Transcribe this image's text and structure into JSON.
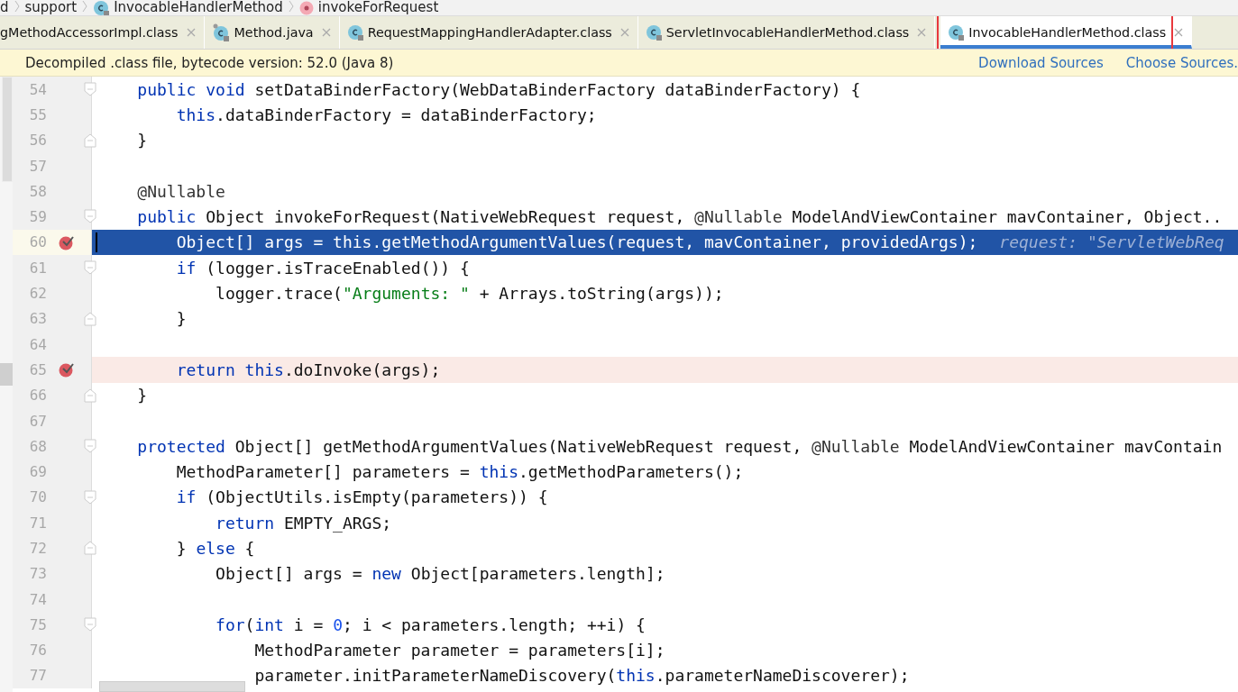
{
  "breadcrumbs": [
    {
      "label": "d",
      "kind": "plain"
    },
    {
      "label": "support",
      "kind": "plain"
    },
    {
      "label": "InvocableHandlerMethod",
      "kind": "class"
    },
    {
      "label": "invokeForRequest",
      "kind": "method"
    }
  ],
  "tabs": [
    {
      "label": "gMethodAccessorImpl.class",
      "kind": "plain",
      "selected": false
    },
    {
      "label": "Method.java",
      "kind": "pinned",
      "selected": false
    },
    {
      "label": "RequestMappingHandlerAdapter.class",
      "kind": "class",
      "selected": false
    },
    {
      "label": "ServletInvocableHandlerMethod.class",
      "kind": "class",
      "selected": false
    },
    {
      "label": "InvocableHandlerMethod.class",
      "kind": "class",
      "selected": true
    }
  ],
  "banner": {
    "message": "Decompiled .class file, bytecode version: 52.0 (Java 8)",
    "links": [
      "Download Sources",
      "Choose Sources."
    ]
  },
  "lines": [
    {
      "number": "54",
      "fold_start": true,
      "fold_end": false,
      "breakpoint": false,
      "execution_point": false,
      "tokens": [
        {
          "kind": "kw",
          "text": "    public void "
        },
        {
          "kind": "plain",
          "text": "setDataBinderFactory(WebDataBinderFactory dataBinderFactory) {"
        }
      ]
    },
    {
      "number": "55",
      "fold_start": false,
      "fold_end": false,
      "breakpoint": false,
      "execution_point": false,
      "tokens": [
        {
          "kind": "kw",
          "text": "        this"
        },
        {
          "kind": "plain",
          "text": ".dataBinderFactory = dataBinderFactory;"
        }
      ]
    },
    {
      "number": "56",
      "fold_start": false,
      "fold_end": true,
      "breakpoint": false,
      "execution_point": false,
      "tokens": [
        {
          "kind": "plain",
          "text": "    }"
        }
      ]
    },
    {
      "number": "57",
      "fold_start": false,
      "fold_end": false,
      "breakpoint": false,
      "execution_point": false
    },
    {
      "number": "58",
      "fold_start": false,
      "fold_end": false,
      "breakpoint": false,
      "execution_point": false,
      "tokens": [
        {
          "kind": "ann",
          "text": "    @Nullable"
        }
      ]
    },
    {
      "number": "59",
      "fold_start": true,
      "fold_end": false,
      "breakpoint": false,
      "execution_point": false,
      "tokens": [
        {
          "kind": "kw",
          "text": "    public "
        },
        {
          "kind": "plain",
          "text": "Object invokeForRequest(NativeWebRequest request, "
        },
        {
          "kind": "ann",
          "text": "@Nullable "
        },
        {
          "kind": "plain",
          "text": "ModelAndViewContainer mavContainer, Object.."
        }
      ]
    },
    {
      "number": "60",
      "fold_start": false,
      "fold_end": false,
      "breakpoint": true,
      "execution_point": true,
      "tokens": [
        {
          "kind": "plain",
          "text": "        Object[] args = "
        },
        {
          "kind": "kw",
          "text": "this"
        },
        {
          "kind": "plain",
          "text": ".getMethodArgumentValues(request, mavContainer, providedArgs);"
        }
      ],
      "hint": "request: \"ServletWebReq"
    },
    {
      "number": "61",
      "fold_start": true,
      "fold_end": false,
      "breakpoint": false,
      "execution_point": false,
      "tokens": [
        {
          "kind": "kw",
          "text": "        if "
        },
        {
          "kind": "plain",
          "text": "(logger.isTraceEnabled()) {"
        }
      ]
    },
    {
      "number": "62",
      "fold_start": false,
      "fold_end": false,
      "breakpoint": false,
      "execution_point": false,
      "tokens": [
        {
          "kind": "plain",
          "text": "            logger.trace("
        },
        {
          "kind": "str",
          "text": "\"Arguments: \""
        },
        {
          "kind": "plain",
          "text": " + Arrays.toString(args));"
        }
      ]
    },
    {
      "number": "63",
      "fold_start": false,
      "fold_end": true,
      "breakpoint": false,
      "execution_point": false,
      "tokens": [
        {
          "kind": "plain",
          "text": "        }"
        }
      ]
    },
    {
      "number": "64",
      "fold_start": false,
      "fold_end": false,
      "breakpoint": false,
      "execution_point": false
    },
    {
      "number": "65",
      "fold_start": false,
      "fold_end": false,
      "breakpoint": true,
      "execution_point": false,
      "tokens": [
        {
          "kind": "kw",
          "text": "        return this"
        },
        {
          "kind": "plain",
          "text": ".doInvoke(args);"
        }
      ]
    },
    {
      "number": "66",
      "fold_start": false,
      "fold_end": true,
      "breakpoint": false,
      "execution_point": false,
      "tokens": [
        {
          "kind": "plain",
          "text": "    }"
        }
      ]
    },
    {
      "number": "67",
      "fold_start": false,
      "fold_end": false,
      "breakpoint": false,
      "execution_point": false
    },
    {
      "number": "68",
      "fold_start": true,
      "fold_end": false,
      "breakpoint": false,
      "execution_point": false,
      "tokens": [
        {
          "kind": "kw",
          "text": "    protected "
        },
        {
          "kind": "plain",
          "text": "Object[] getMethodArgumentValues(NativeWebRequest request, "
        },
        {
          "kind": "ann",
          "text": "@Nullable "
        },
        {
          "kind": "plain",
          "text": "ModelAndViewContainer mavContain"
        }
      ]
    },
    {
      "number": "69",
      "fold_start": false,
      "fold_end": false,
      "breakpoint": false,
      "execution_point": false,
      "tokens": [
        {
          "kind": "plain",
          "text": "        MethodParameter[] parameters = "
        },
        {
          "kind": "kw",
          "text": "this"
        },
        {
          "kind": "plain",
          "text": ".getMethodParameters();"
        }
      ]
    },
    {
      "number": "70",
      "fold_start": true,
      "fold_end": false,
      "breakpoint": false,
      "execution_point": false,
      "tokens": [
        {
          "kind": "kw",
          "text": "        if "
        },
        {
          "kind": "plain",
          "text": "(ObjectUtils.isEmpty(parameters)) {"
        }
      ]
    },
    {
      "number": "71",
      "fold_start": false,
      "fold_end": false,
      "breakpoint": false,
      "execution_point": false,
      "tokens": [
        {
          "kind": "kw",
          "text": "            return "
        },
        {
          "kind": "plain",
          "text": "EMPTY_ARGS;"
        }
      ]
    },
    {
      "number": "72",
      "fold_start": false,
      "fold_end": true,
      "breakpoint": false,
      "execution_point": false,
      "tokens": [
        {
          "kind": "plain",
          "text": "        } "
        },
        {
          "kind": "kw",
          "text": "else "
        },
        {
          "kind": "plain",
          "text": "{"
        }
      ]
    },
    {
      "number": "73",
      "fold_start": false,
      "fold_end": false,
      "breakpoint": false,
      "execution_point": false,
      "tokens": [
        {
          "kind": "plain",
          "text": "            Object[] args = "
        },
        {
          "kind": "kw",
          "text": "new "
        },
        {
          "kind": "plain",
          "text": "Object[parameters.length];"
        }
      ]
    },
    {
      "number": "74",
      "fold_start": false,
      "fold_end": false,
      "breakpoint": false,
      "execution_point": false
    },
    {
      "number": "75",
      "fold_start": true,
      "fold_end": false,
      "breakpoint": false,
      "execution_point": false,
      "tokens": [
        {
          "kind": "kw",
          "text": "            for"
        },
        {
          "kind": "plain",
          "text": "("
        },
        {
          "kind": "kw",
          "text": "int "
        },
        {
          "kind": "plain",
          "text": "i = "
        },
        {
          "kind": "num",
          "text": "0"
        },
        {
          "kind": "plain",
          "text": "; i < parameters.length; ++i) {"
        }
      ]
    },
    {
      "number": "76",
      "fold_start": false,
      "fold_end": false,
      "breakpoint": false,
      "execution_point": false,
      "tokens": [
        {
          "kind": "plain",
          "text": "                MethodParameter parameter = parameters[i];"
        }
      ]
    },
    {
      "number": "77",
      "fold_start": false,
      "fold_end": false,
      "breakpoint": false,
      "execution_point": false,
      "tokens": [
        {
          "kind": "plain",
          "text": "                parameter.initParameterNameDiscovery("
        },
        {
          "kind": "kw",
          "text": "this"
        },
        {
          "kind": "plain",
          "text": ".parameterNameDiscoverer);"
        }
      ]
    }
  ]
}
